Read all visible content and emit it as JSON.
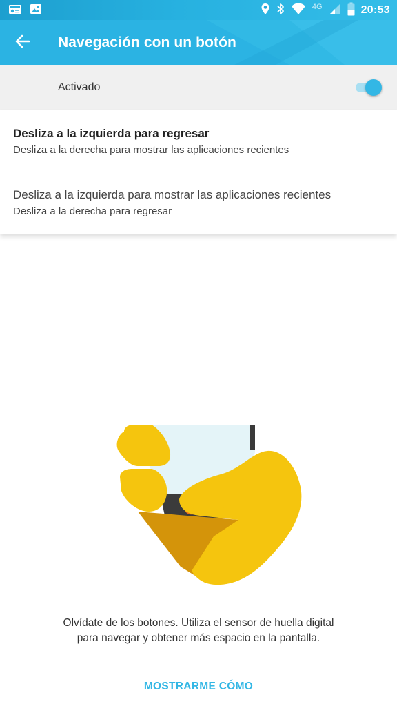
{
  "status_bar": {
    "time": "20:53",
    "network": "4G",
    "left_icons": [
      "radio-icon",
      "image-icon"
    ],
    "right_icons": [
      "location-icon",
      "bluetooth-icon",
      "wifi-icon",
      "signal-icon",
      "battery-icon"
    ]
  },
  "app_bar": {
    "title": "Navegación con un botón",
    "back_icon": "arrow-left-icon",
    "color": "#2bb3e3"
  },
  "master_switch": {
    "label": "Activado",
    "on": true,
    "accent": "#33b7e5"
  },
  "options": [
    {
      "title": "Desliza a la izquierda para regresar",
      "subtitle": "Desliza a la derecha para mostrar las aplicaciones recientes",
      "selected": true
    },
    {
      "title": "Desliza a la izquierda para mostrar las aplicaciones recientes",
      "subtitle": "Desliza a la derecha para regresar",
      "selected": false
    }
  ],
  "description": {
    "line1": "Olvídate de los botones. Utiliza el sensor de huella digital",
    "line2": "para navegar y obtener más espacio en la pantalla."
  },
  "action": {
    "label": "MOSTRARME CÓMO"
  }
}
